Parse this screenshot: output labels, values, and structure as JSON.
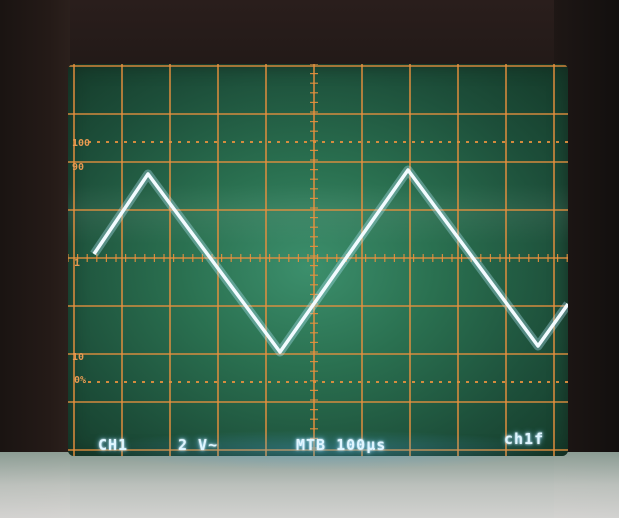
{
  "scope": {
    "markers": {
      "top": "100",
      "ninety": "90",
      "ground": "1",
      "ten": "10",
      "zero": "0%"
    },
    "readouts": {
      "channel": "CH1",
      "volts_per_div": "2 V~",
      "timebase": "MTB 100µs",
      "trigger": "ch1f"
    },
    "colors": {
      "graticule": "#e8913e",
      "trace": "#f2fbff",
      "phosphor": "#2a7050"
    }
  }
}
